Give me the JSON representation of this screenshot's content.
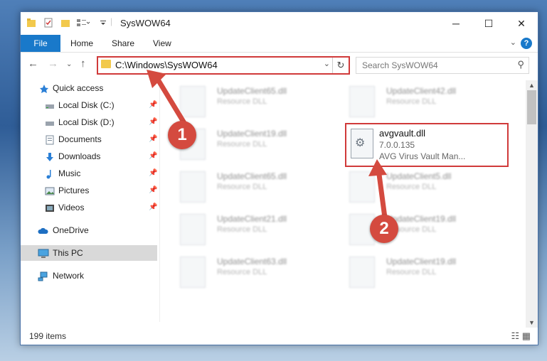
{
  "titlebar": {
    "title": "SysWOW64",
    "minimize": "─",
    "maximize": "☐",
    "close": "✕"
  },
  "ribbon": {
    "file": "File",
    "home": "Home",
    "share": "Share",
    "view": "View",
    "help": "?"
  },
  "nav": {
    "address": "C:\\Windows\\SysWOW64",
    "search_placeholder": "Search SysWOW64"
  },
  "sidebar": {
    "items": [
      {
        "label": "Quick access",
        "icon": "star-icon"
      },
      {
        "label": "Local Disk (C:)",
        "icon": "drive-icon"
      },
      {
        "label": "Local Disk (D:)",
        "icon": "drive-icon"
      },
      {
        "label": "Documents",
        "icon": "documents-icon"
      },
      {
        "label": "Downloads",
        "icon": "download-icon"
      },
      {
        "label": "Music",
        "icon": "music-icon"
      },
      {
        "label": "Pictures",
        "icon": "pictures-icon"
      },
      {
        "label": "Videos",
        "icon": "videos-icon"
      },
      {
        "label": "OneDrive",
        "icon": "cloud-icon"
      },
      {
        "label": "This PC",
        "icon": "computer-icon"
      },
      {
        "label": "Network",
        "icon": "network-icon"
      }
    ]
  },
  "files": [
    {
      "name": "UpdateClient65.dll",
      "type": "Resource DLL"
    },
    {
      "name": "UpdateClient42.dll",
      "type": "Resource DLL"
    },
    {
      "name": "UpdateClient19.dll",
      "type": "Resource DLL"
    },
    {
      "name": "UpdateClient65.dll",
      "type": "Resource DLL"
    },
    {
      "name": "UpdateClient5.dll",
      "type": "Resource DLL"
    },
    {
      "name": "UpdateClient21.dll",
      "type": "Resource DLL"
    },
    {
      "name": "UpdateClient19.dll",
      "type": "Resource DLL"
    },
    {
      "name": "UpdateClient63.dll",
      "type": "Resource DLL"
    },
    {
      "name": "UpdateClient19.dll",
      "type": "Resource DLL"
    }
  ],
  "selected_file": {
    "name": "avgvault.dll",
    "version": "7.0.0.135",
    "description": "AVG Virus Vault Man..."
  },
  "status": {
    "count": "199 items"
  },
  "annotations": {
    "step1": "1",
    "step2": "2",
    "color": "#d44a3f"
  }
}
